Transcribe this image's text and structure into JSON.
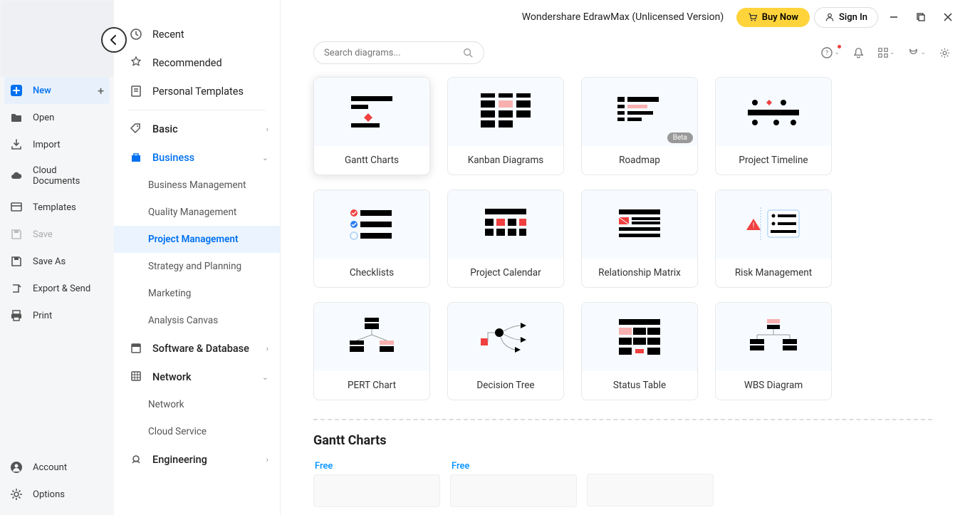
{
  "app_title": "Wondershare EdrawMax (Unlicensed Version)",
  "buy_label": "Buy Now",
  "signin_label": "Sign In",
  "search_placeholder": "Search diagrams...",
  "far_sidebar": {
    "new": "New",
    "open": "Open",
    "import": "Import",
    "cloud": "Cloud Documents",
    "templates": "Templates",
    "save": "Save",
    "saveas": "Save As",
    "export": "Export & Send",
    "print": "Print",
    "account": "Account",
    "options": "Options"
  },
  "categories": {
    "recent": "Recent",
    "recommended": "Recommended",
    "personal": "Personal Templates",
    "basic": "Basic",
    "business": "Business",
    "business_subs": [
      "Business Management",
      "Quality Management",
      "Project Management",
      "Strategy and Planning",
      "Marketing",
      "Analysis Canvas"
    ],
    "software": "Software & Database",
    "network": "Network",
    "network_subs": [
      "Network",
      "Cloud Service"
    ],
    "engineering": "Engineering"
  },
  "template_cards": [
    {
      "label": "Gantt Charts",
      "badge": null
    },
    {
      "label": "Kanban Diagrams",
      "badge": null
    },
    {
      "label": "Roadmap",
      "badge": "Beta"
    },
    {
      "label": "Project Timeline",
      "badge": null
    },
    {
      "label": "Checklists",
      "badge": null
    },
    {
      "label": "Project Calendar",
      "badge": null
    },
    {
      "label": "Relationship Matrix",
      "badge": null
    },
    {
      "label": "Risk Management",
      "badge": null
    },
    {
      "label": "PERT Chart",
      "badge": null
    },
    {
      "label": "Decision Tree",
      "badge": null
    },
    {
      "label": "Status Table",
      "badge": null
    },
    {
      "label": "WBS Diagram",
      "badge": null
    }
  ],
  "section_heading": "Gantt Charts",
  "free_label": "Free"
}
